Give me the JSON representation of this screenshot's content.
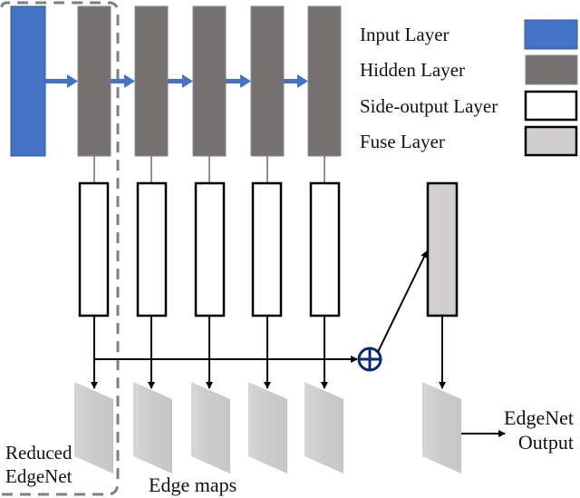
{
  "legend": {
    "items": [
      {
        "label": "Input Layer",
        "fill": "#4472c4",
        "stroke": "#2f5597"
      },
      {
        "label": "Hidden Layer",
        "fill": "#757171",
        "stroke": "#8a8686"
      },
      {
        "label": "Side-output Layer",
        "fill": "#ffffff",
        "stroke": "#000000"
      },
      {
        "label": "Fuse Layer",
        "fill": "#d0cece",
        "stroke": "#000000"
      }
    ]
  },
  "colors": {
    "input": "#4472c4",
    "hidden": "#757171",
    "side_output": "#ffffff",
    "fuse": "#d0cece",
    "arrow_blue": "#4472c4",
    "sum_node": "#0d2a6e",
    "edge_map": "#cfcfcf",
    "dashed_box": "#7f7f7f"
  },
  "network": {
    "hidden_layer_count": 5,
    "side_output_count": 5,
    "edge_map_count": 5,
    "sum_symbol": "⊕"
  },
  "labels": {
    "reduced_line1": "Reduced",
    "reduced_line2": "EdgeNet",
    "edge_maps": "Edge maps",
    "output_line1": "EdgeNet",
    "output_line2": "Output"
  }
}
